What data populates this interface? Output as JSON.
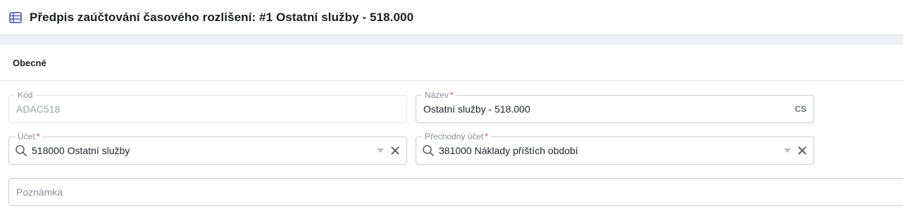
{
  "header": {
    "title_icon": "table-icon",
    "title": "Předpis zaúčtování časového rozlišení: #1 Ostatní služby - 518.000"
  },
  "section": {
    "label": "Obecné"
  },
  "fields": {
    "kod": {
      "label": "Kód",
      "value": "ADAC518",
      "disabled": true
    },
    "nazev": {
      "label": "Název",
      "required": "*",
      "value": "Ostatní služby - 518.000",
      "lang": "CS"
    },
    "ucet": {
      "label": "Účet",
      "required": "*",
      "value": "518000 Ostatní služby",
      "icon": "search-icon"
    },
    "prechodny_ucet": {
      "label": "Přechodný účet",
      "required": "*",
      "value": "381000 Náklady příštích období",
      "icon": "search-icon"
    },
    "poznamka": {
      "placeholder": "Poznámka",
      "value": ""
    }
  },
  "colors": {
    "accent": "#3f51b5",
    "required": "#e53935",
    "border": "#c9ccd1"
  }
}
